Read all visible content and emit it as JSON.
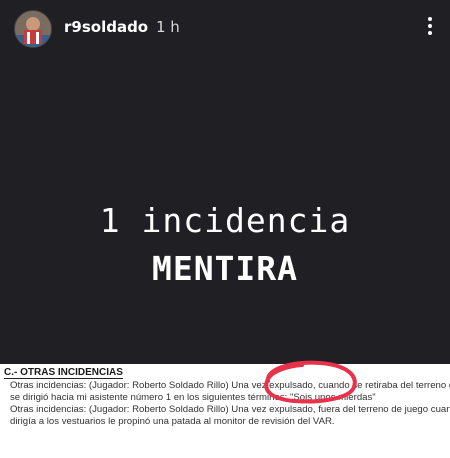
{
  "header": {
    "username": "r9soldado",
    "timestamp": "1 h"
  },
  "story": {
    "line1": "1 incidencia",
    "line2": "MENTIRA"
  },
  "document": {
    "heading": "C.- OTRAS INCIDENCIAS",
    "lines": [
      "Otras incidencias: (Jugador: Roberto Soldado Rillo) Una vez expulsado, cuando se retiraba del terreno de juego",
      "se dirigió hacia mi asistente número 1 en los siguientes términos: \"Sois unos mierdas\"",
      "Otras incidencias: (Jugador: Roberto Soldado Rillo) Una vez expulsado, fuera del terreno de juego cuando se",
      "dirigía a los vestuarios le propinó una patada al monitor de revisión del VAR."
    ]
  },
  "colors": {
    "background": "#1f1f24",
    "annotation": "#e8324a"
  },
  "icons": {
    "menu": "more-vertical-icon"
  }
}
